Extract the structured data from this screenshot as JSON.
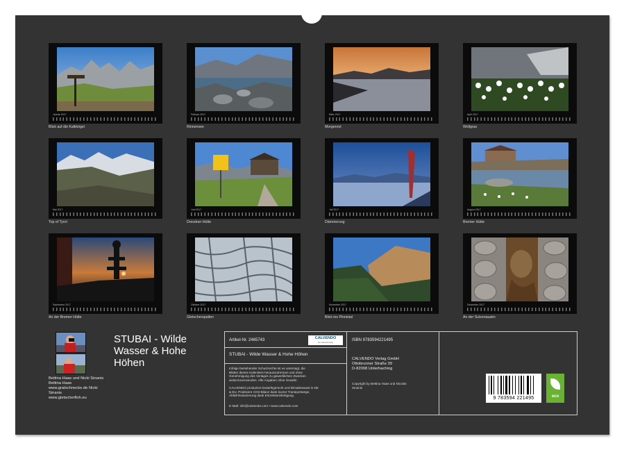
{
  "months": [
    {
      "caption": "Blick auf die Kalkkögel",
      "month": "Januar 2017"
    },
    {
      "caption": "Rinnensee",
      "month": "Februar 2017"
    },
    {
      "caption": "Morgenrot",
      "month": "März 2017"
    },
    {
      "caption": "Wollgras",
      "month": "April 2017"
    },
    {
      "caption": "Top of Tyrol",
      "month": "Mai 2017"
    },
    {
      "caption": "Dresdner Hütte",
      "month": "Juni 2017"
    },
    {
      "caption": "Dämmerung",
      "month": "Juli 2017"
    },
    {
      "caption": "Bremer Hütte",
      "month": "August 2017"
    },
    {
      "caption": "An der Bremer Hütte",
      "month": "September 2017"
    },
    {
      "caption": "Gletscherspalten",
      "month": "Oktober 2017"
    },
    {
      "caption": "Blick ins Pinnistal",
      "month": "November 2017"
    },
    {
      "caption": "An der Sulzenaualm",
      "month": "Dezember 2017"
    }
  ],
  "title": "STUBAI - Wilde Wasser & Hohe Höhen",
  "authors": {
    "names": "Bettina Haas und Nicki Sinanis",
    "line1": "Bettina Haas",
    "line2": "www.gratschnecke.de Nicki",
    "line3": "Sinanis",
    "line4": "www.gletscherfloh.eu"
  },
  "info": {
    "article": "Artikel-Nr. 2465743",
    "publisher_logo": "CALVENDO",
    "publisher_tagline": "Der Kalenderverlag",
    "calendar_title": "STUBAI - Wilde Wasser & Hohe Höhen",
    "legal_1": "Infolge bestehender Schutzrechte ist es untersagt, die",
    "legal_2": "Blätter dieses Kalenders herauszutrennen und ohne",
    "legal_3": "Genehmigung des Verlages zu gewerblichen Zwecken",
    "legal_4": "weiterzuverwenden. Alle Angaben ohne Gewähr.",
    "eco_1": "CALVENDO produziert bedarfsgerecht und klimabewusst in DE",
    "eco_2": "& EU. Positivere CO2-Bilanz dank kurzer Transportwege,",
    "eco_3": "Abfall-Reduzierung dank Einzelstückfertigung.",
    "email": "E-Mail: info@calvendo.com • www.calvendo.com",
    "isbn": "ISBN 9783594221495",
    "publisher_1": "CALVENDO Verlag GmbH",
    "publisher_2": "Ottobrunner Straße 39",
    "publisher_3": "D-82008 Unterhaching",
    "copyright_1": "Copyright by Bettina Haas und Nicolas",
    "copyright_2": "Sinanis",
    "barcode_number": "9 783594 221495",
    "eco_label": "eco"
  },
  "colors": {
    "background": "#333333",
    "page": "#ffffff",
    "eco_badge": "#6ab233",
    "logo_blue": "#0a5a8c"
  }
}
